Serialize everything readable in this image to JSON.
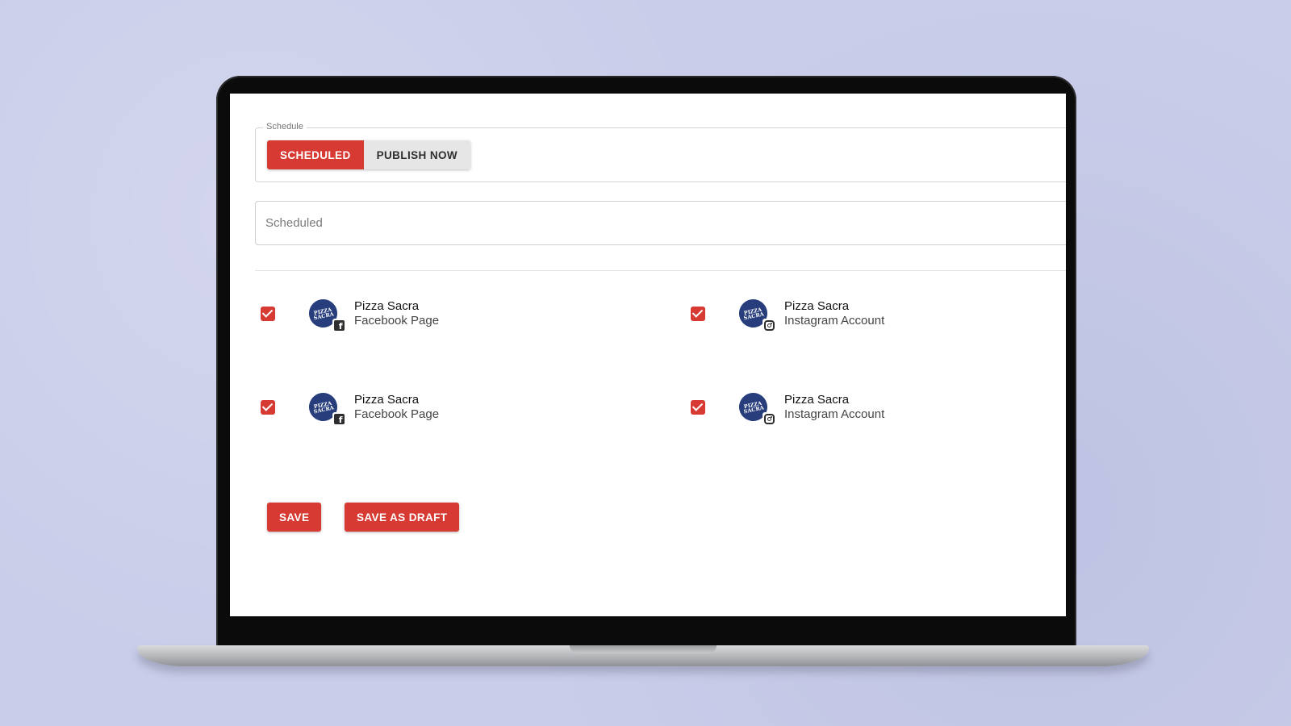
{
  "schedule": {
    "legend": "Schedule",
    "options": [
      {
        "label": "SCHEDULED",
        "active": true
      },
      {
        "label": "PUBLISH NOW",
        "active": false
      }
    ]
  },
  "status_field": {
    "value": "Scheduled"
  },
  "accounts": [
    {
      "name": "Pizza Sacra",
      "type": "Facebook Page",
      "platform": "facebook-icon",
      "checked": true,
      "avatar_text": "PIZZA SACRA"
    },
    {
      "name": "Pizza Sacra",
      "type": "Instagram Account",
      "platform": "instagram-icon",
      "checked": true,
      "avatar_text": "PIZZA SACRA"
    },
    {
      "name": "Pizza Sacra",
      "type": "Facebook Page",
      "platform": "facebook-icon",
      "checked": true,
      "avatar_text": "PIZZA SACRA"
    },
    {
      "name": "Pizza Sacra",
      "type": "Instagram Account",
      "platform": "instagram-icon",
      "checked": true,
      "avatar_text": "PIZZA SACRA"
    }
  ],
  "actions": {
    "save_label": "SAVE",
    "save_draft_label": "SAVE AS DRAFT"
  },
  "colors": {
    "accent": "#d63a32",
    "avatar_bg": "#273d7c",
    "background": "#c9cde9"
  }
}
